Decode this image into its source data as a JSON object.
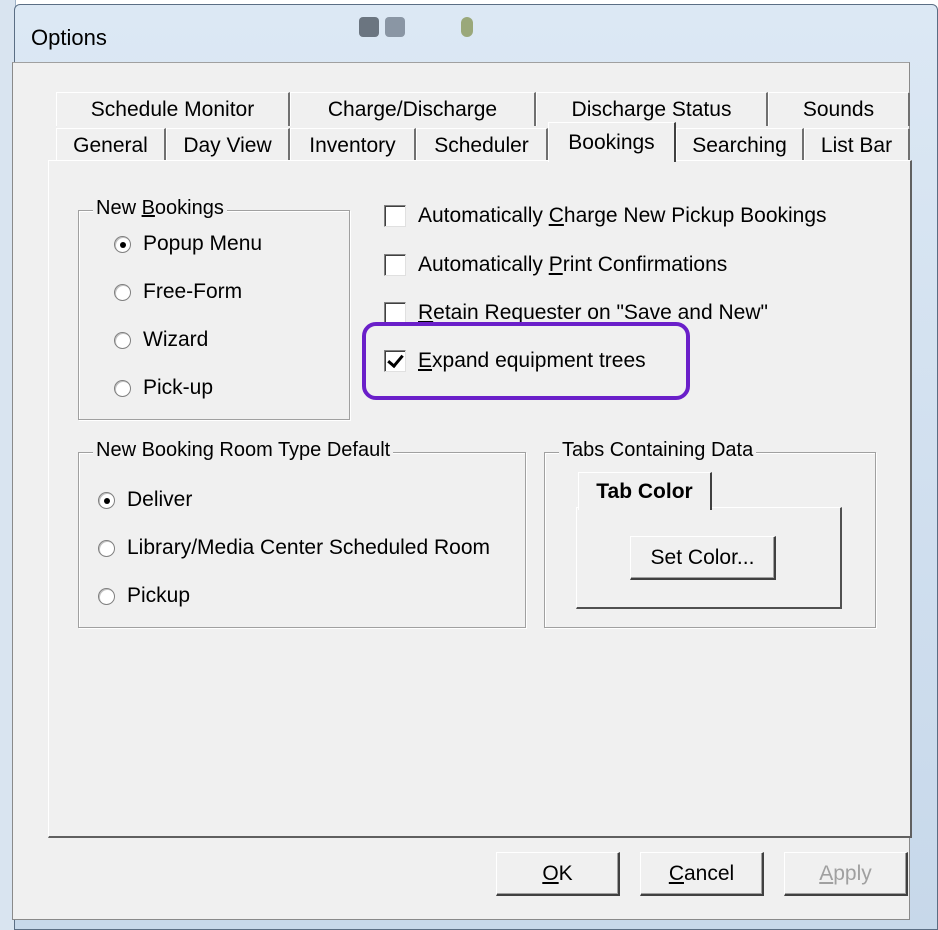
{
  "window": {
    "title": "Options"
  },
  "tabs_back_row": [
    "Schedule Monitor",
    "Charge/Discharge",
    "Discharge Status",
    "Sounds"
  ],
  "tabs_front_row": [
    "General",
    "Day View",
    "Inventory",
    "Scheduler",
    "Bookings",
    "Searching",
    "List Bar"
  ],
  "active_tab": "Bookings",
  "new_bookings": {
    "label_pre": "New ",
    "label_mn": "B",
    "label_post": "ookings",
    "options": [
      {
        "label": "Popup Menu",
        "selected": true
      },
      {
        "label": "Free-Form",
        "selected": false
      },
      {
        "label": "Wizard",
        "selected": false
      },
      {
        "label": "Pick-up",
        "selected": false
      }
    ]
  },
  "checkboxes": [
    {
      "pre": "Automatically ",
      "mn": "C",
      "post": "harge New Pickup Bookings",
      "checked": false
    },
    {
      "pre": "Automatically ",
      "mn": "P",
      "post": "rint Confirmations",
      "checked": false
    },
    {
      "pre": "",
      "mn": "R",
      "post": "etain Requester on \"Save and New\"",
      "checked": false
    },
    {
      "pre": "",
      "mn": "E",
      "post": "xpand equipment trees",
      "checked": true
    }
  ],
  "room_type": {
    "label": "New Booking Room Type Default",
    "options": [
      {
        "label": "Deliver",
        "selected": true
      },
      {
        "label": "Library/Media Center Scheduled Room",
        "selected": false
      },
      {
        "label": "Pickup",
        "selected": false
      }
    ]
  },
  "tabs_data": {
    "label": "Tabs Containing Data",
    "tab_label": "Tab Color",
    "set_color": "Set Color..."
  },
  "buttons": {
    "ok_mn": "O",
    "ok_post": "K",
    "cancel_mn": "C",
    "cancel_post": "ancel",
    "apply_mn": "A",
    "apply_post": "pply"
  },
  "colors": {
    "highlight": "#6a1fc9",
    "dialog_bg": "#f0f0f0",
    "frame": "#cfdeee"
  }
}
